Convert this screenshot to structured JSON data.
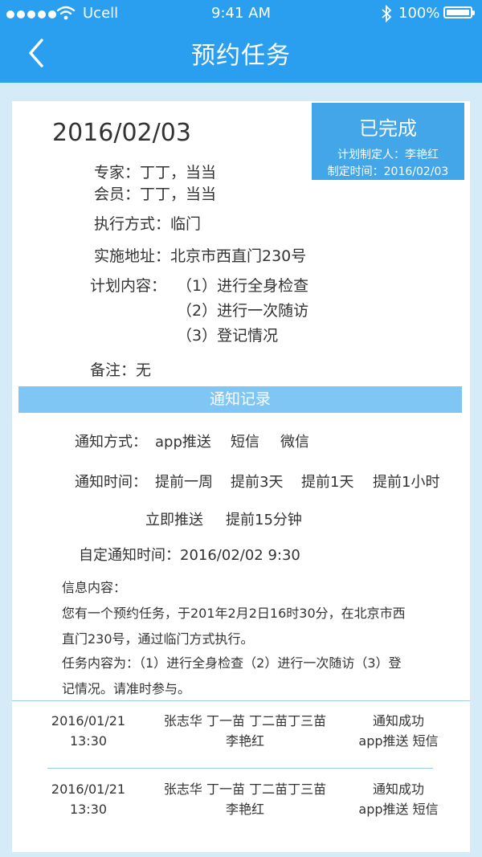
{
  "status_bar": {
    "carrier": "Ucell",
    "time": "9:41 AM",
    "battery": "100%"
  },
  "header": {
    "title": "预约任务"
  },
  "task": {
    "date": "2016/02/03",
    "status": "已完成",
    "planner": "计划制定人：李艳红",
    "plan_time": "制定时间：2016/02/03",
    "expert": "专家：丁丁，当当",
    "member": "会员：丁丁，当当",
    "method": "执行方式：临门",
    "address": "实施地址：北京市西直门230号",
    "content_label": "计划内容：",
    "content_items": [
      "（1）进行全身检查",
      "（2）进行一次随访",
      "（3）登记情况"
    ],
    "remark": "备注：无"
  },
  "notify": {
    "section_title": "通知记录",
    "method_label": "通知方式：",
    "methods": [
      "app推送",
      "短信",
      "微信"
    ],
    "time_label": "通知时间：",
    "times_row1": [
      "提前一周",
      "提前3天",
      "提前1天",
      "提前1小时"
    ],
    "times_row2": [
      "立即推送",
      "提前15分钟"
    ],
    "custom_time": "自定通知时间：2016/02/02  9:30",
    "message_label": "信息内容：",
    "message_lines": [
      "您有一个预约任务，于201年2月2日16时30分，在北京市西",
      "直门230号，通过临门方式执行。",
      "任务内容为：（1）进行全身检查（2）进行一次随访（3）登",
      "记情况。请准时参与。"
    ]
  },
  "log": [
    {
      "date": "2016/01/21",
      "time": "13:30",
      "people1": "张志华 丁一苗 丁二苗丁三苗",
      "people2": "李艳红",
      "result": "通知成功",
      "channels": "app推送 短信"
    },
    {
      "date": "2016/01/21",
      "time": "13:30",
      "people1": "张志华 丁一苗 丁二苗丁三苗",
      "people2": "李艳红",
      "result": "通知成功",
      "channels": "app推送 短信"
    }
  ],
  "colors": {
    "header_blue": "#2a9ff0",
    "status_box": "#43a6e8",
    "section_bar": "#7fc6f5",
    "page_bg": "#d6ebf8"
  },
  "icons": [
    "signal-dots-icon",
    "wifi-icon",
    "bluetooth-icon",
    "battery-icon",
    "back-chevron-icon"
  ]
}
